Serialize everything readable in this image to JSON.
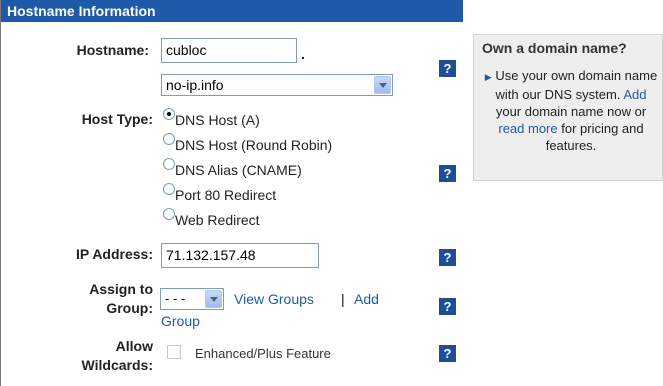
{
  "header": {
    "title": "Hostname Information"
  },
  "hostname": {
    "label": "Hostname:",
    "value": "cubloc",
    "dot": ".",
    "domain_selected": "no-ip.info"
  },
  "host_type": {
    "label": "Host Type:",
    "options": [
      {
        "label": "DNS Host (A)",
        "checked": true
      },
      {
        "label": "DNS Host (Round Robin)",
        "checked": false
      },
      {
        "label": "DNS Alias (CNAME)",
        "checked": false
      },
      {
        "label": "Port 80 Redirect",
        "checked": false
      },
      {
        "label": "Web Redirect",
        "checked": false
      }
    ]
  },
  "ip_address": {
    "label": "IP Address:",
    "value": "71.132.157.48"
  },
  "assign_group": {
    "label_line1": "Assign to",
    "label_line2": "Group:",
    "selected": "- - -",
    "view_groups": "View Groups",
    "separator": "|",
    "add_group_line1": "Add",
    "add_group_line2": "Group"
  },
  "wildcards": {
    "label_line1": "Allow",
    "label_line2": "Wildcards:",
    "feature_text": "Enhanced/Plus Feature",
    "checked": false
  },
  "help": {
    "glyph": "?"
  },
  "side": {
    "title": "Own a domain name?",
    "text_1": "Use your own domain name with our DNS system.",
    "link_add": "Add",
    "text_2": "your domain name now or",
    "link_read_more": "read more",
    "text_3": "for pricing and features."
  },
  "colors": {
    "header_bg": "#1e5aa8",
    "link": "#1e5aa8",
    "help_bg": "#1e4f96",
    "side_bg": "#eeeeee"
  },
  "icons": [
    "help-icon",
    "dropdown-arrow-icon",
    "bullet-arrow-icon"
  ]
}
